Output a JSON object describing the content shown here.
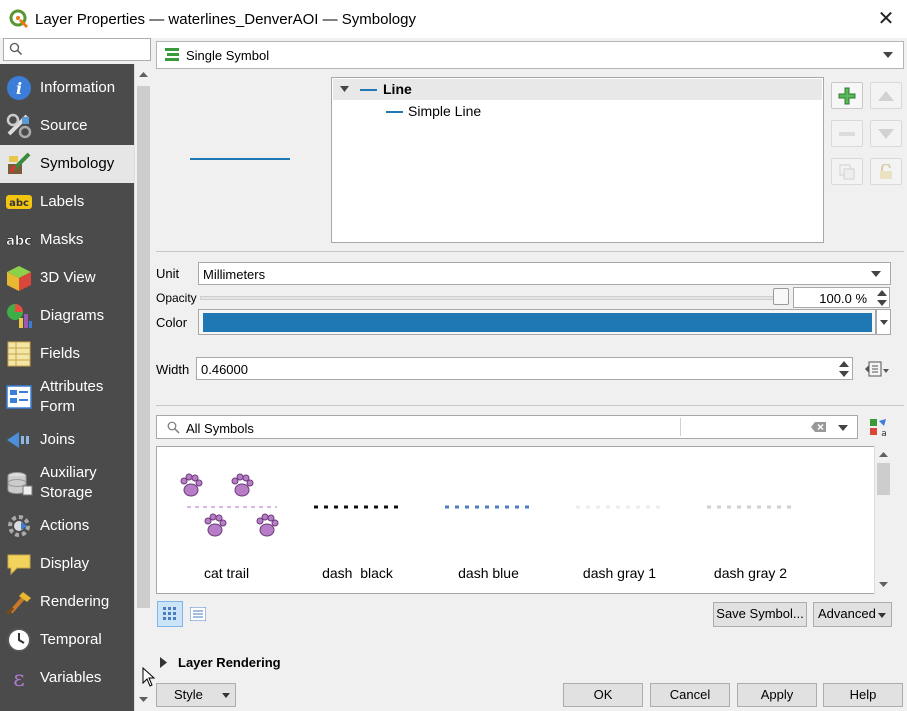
{
  "window": {
    "title": "Layer Properties — waterlines_DenverAOI — Symbology",
    "close_glyph": "✕"
  },
  "sidebar": {
    "search_placeholder": "",
    "items": [
      {
        "label": "Information",
        "icon": "info-icon"
      },
      {
        "label": "Source",
        "icon": "source-icon"
      },
      {
        "label": "Symbology",
        "icon": "symbology-icon",
        "active": true
      },
      {
        "label": "Labels",
        "icon": "labels-icon"
      },
      {
        "label": "Masks",
        "icon": "masks-icon"
      },
      {
        "label": "3D View",
        "icon": "3d-view-icon"
      },
      {
        "label": "Diagrams",
        "icon": "diagrams-icon"
      },
      {
        "label": "Fields",
        "icon": "fields-icon"
      },
      {
        "label": "Attributes\nForm",
        "icon": "attributes-form-icon"
      },
      {
        "label": "Joins",
        "icon": "joins-icon"
      },
      {
        "label": "Auxiliary\nStorage",
        "icon": "auxiliary-storage-icon"
      },
      {
        "label": "Actions",
        "icon": "actions-icon"
      },
      {
        "label": "Display",
        "icon": "display-icon"
      },
      {
        "label": "Rendering",
        "icon": "rendering-icon"
      },
      {
        "label": "Temporal",
        "icon": "temporal-icon"
      },
      {
        "label": "Variables",
        "icon": "variables-icon"
      }
    ]
  },
  "renderer": {
    "label": "Single Symbol"
  },
  "symbol_tree": {
    "root": "Line",
    "child": "Simple Line"
  },
  "properties": {
    "unit_label": "Unit",
    "unit_value": "Millimeters",
    "opacity_label": "Opacity",
    "opacity_value": "100.0 %",
    "opacity_fraction": 1.0,
    "color_label": "Color",
    "color_value": "#1f78b4",
    "width_label": "Width",
    "width_value": "0.46000"
  },
  "library": {
    "search_value": "All Symbols",
    "symbols": [
      {
        "name": "cat trail"
      },
      {
        "name": "dash  black"
      },
      {
        "name": "dash blue"
      },
      {
        "name": "dash gray 1"
      },
      {
        "name": "dash gray 2"
      }
    ],
    "save_button": "Save Symbol...",
    "advanced_button": "Advanced"
  },
  "layer_rendering": {
    "label": "Layer Rendering"
  },
  "footer": {
    "style_button": "Style",
    "ok_button": "OK",
    "cancel_button": "Cancel",
    "apply_button": "Apply",
    "help_button": "Help"
  }
}
